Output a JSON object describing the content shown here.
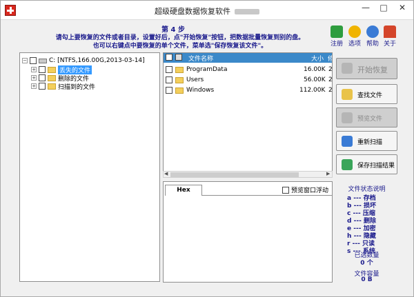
{
  "window": {
    "title": "超级硬盘数据恢复软件",
    "controls": {
      "minimize": "—",
      "maximize": "□",
      "close": "✕"
    }
  },
  "instructions": {
    "step": "第 4 步",
    "line1": "请勾上要恢复的文件或者目录，设置好后，点\"开始恢复\"按钮，把数据批量恢复到别的盘。",
    "line2": "也可以右键点中要恢复的单个文件，菜单选\"保存恢复该文件\"。"
  },
  "toolbar": {
    "register": "注册",
    "options": "选项",
    "help": "帮助",
    "about": "关于"
  },
  "tree": {
    "root": "C:  [NTFS,166.00G,2013-03-14]",
    "items": [
      {
        "label": "丢失的文件",
        "selected": true
      },
      {
        "label": "删除的文件",
        "selected": false
      },
      {
        "label": "扫描到的文件",
        "selected": false
      }
    ]
  },
  "file_list": {
    "columns": {
      "name": "文件名称",
      "size": "大小",
      "extra": "修"
    },
    "rows": [
      {
        "name": "ProgramData",
        "size": "16.00K",
        "extra": "2"
      },
      {
        "name": "Users",
        "size": "56.00K",
        "extra": "2"
      },
      {
        "name": "Windows",
        "size": "112.00K",
        "extra": "2"
      }
    ]
  },
  "hex": {
    "tab": "Hex",
    "float_label": "预览窗口浮动"
  },
  "actions": {
    "start_recover": "开始恢复",
    "find_file": "查找文件",
    "preview_file": "预览文件",
    "rescan": "重新扫描",
    "save_scan": "保存扫描结果"
  },
  "legend": {
    "title": "文件状态说明",
    "items": [
      {
        "key": "a",
        "text": "存档"
      },
      {
        "key": "b",
        "text": "损坏"
      },
      {
        "key": "c",
        "text": "压缩"
      },
      {
        "key": "d",
        "text": "删除"
      },
      {
        "key": "e",
        "text": "加密"
      },
      {
        "key": "h",
        "text": "隐藏"
      },
      {
        "key": "r",
        "text": "只读"
      },
      {
        "key": "s",
        "text": "系统"
      }
    ],
    "separator": "---"
  },
  "stats": {
    "selected_label": "已选数量",
    "selected_value": "0 个",
    "capacity_label": "文件容量",
    "capacity_value": "0 B"
  },
  "colors": {
    "accent": "#3b89c9",
    "instruction_text": "#1a1a8c",
    "selection": "#3399ff"
  }
}
